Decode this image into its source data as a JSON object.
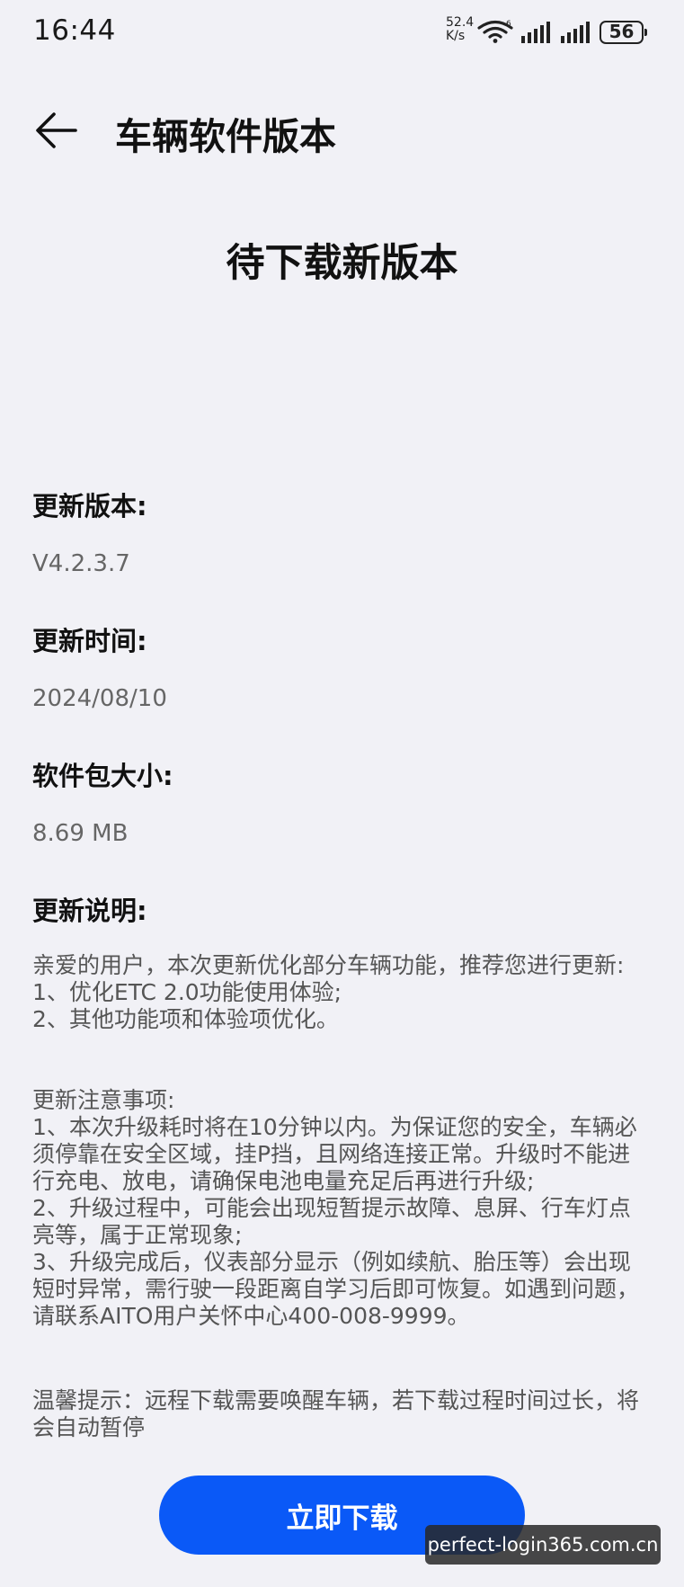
{
  "status_bar": {
    "time": "16:44",
    "net_speed_value": "52.4",
    "net_speed_unit": "K/s",
    "battery": "56"
  },
  "header": {
    "title": "车辆软件版本"
  },
  "heading": "待下载新版本",
  "version": {
    "label": "更新版本:",
    "value": "V4.2.3.7"
  },
  "update_time": {
    "label": "更新时间:",
    "value": "2024/08/10"
  },
  "package_size": {
    "label": "软件包大小:",
    "value": "8.69 MB"
  },
  "notes": {
    "label": "更新说明:",
    "intro": "亲爱的用户，本次更新优化部分车辆功能，推荐您进行更新:",
    "items": [
      "1、优化ETC 2.0功能使用体验;",
      "2、其他功能项和体验项优化。"
    ],
    "precautions_title": "更新注意事项:",
    "precautions": [
      "1、本次升级耗时将在10分钟以内。为保证您的安全，车辆必须停靠在安全区域，挂P挡，且网络连接正常。升级时不能进行充电、放电，请确保电池电量充足后再进行升级;",
      "2、升级过程中，可能会出现短暂提示故障、息屏、行车灯点亮等，属于正常现象;",
      "3、升级完成后，仪表部分显示（例如续航、胎压等）会出现短时异常，需行驶一段距离自学习后即可恢复。如遇到问题，请联系AITO用户关怀中心400-008-9999。"
    ],
    "tip": "温馨提示：远程下载需要唤醒车辆，若下载过程时间过长，将会自动暂停"
  },
  "download_button": "立即下载",
  "watermark": "perfect-login365.com.cn",
  "colors": {
    "background": "#f1f1f6",
    "primary": "#0a59f7"
  }
}
